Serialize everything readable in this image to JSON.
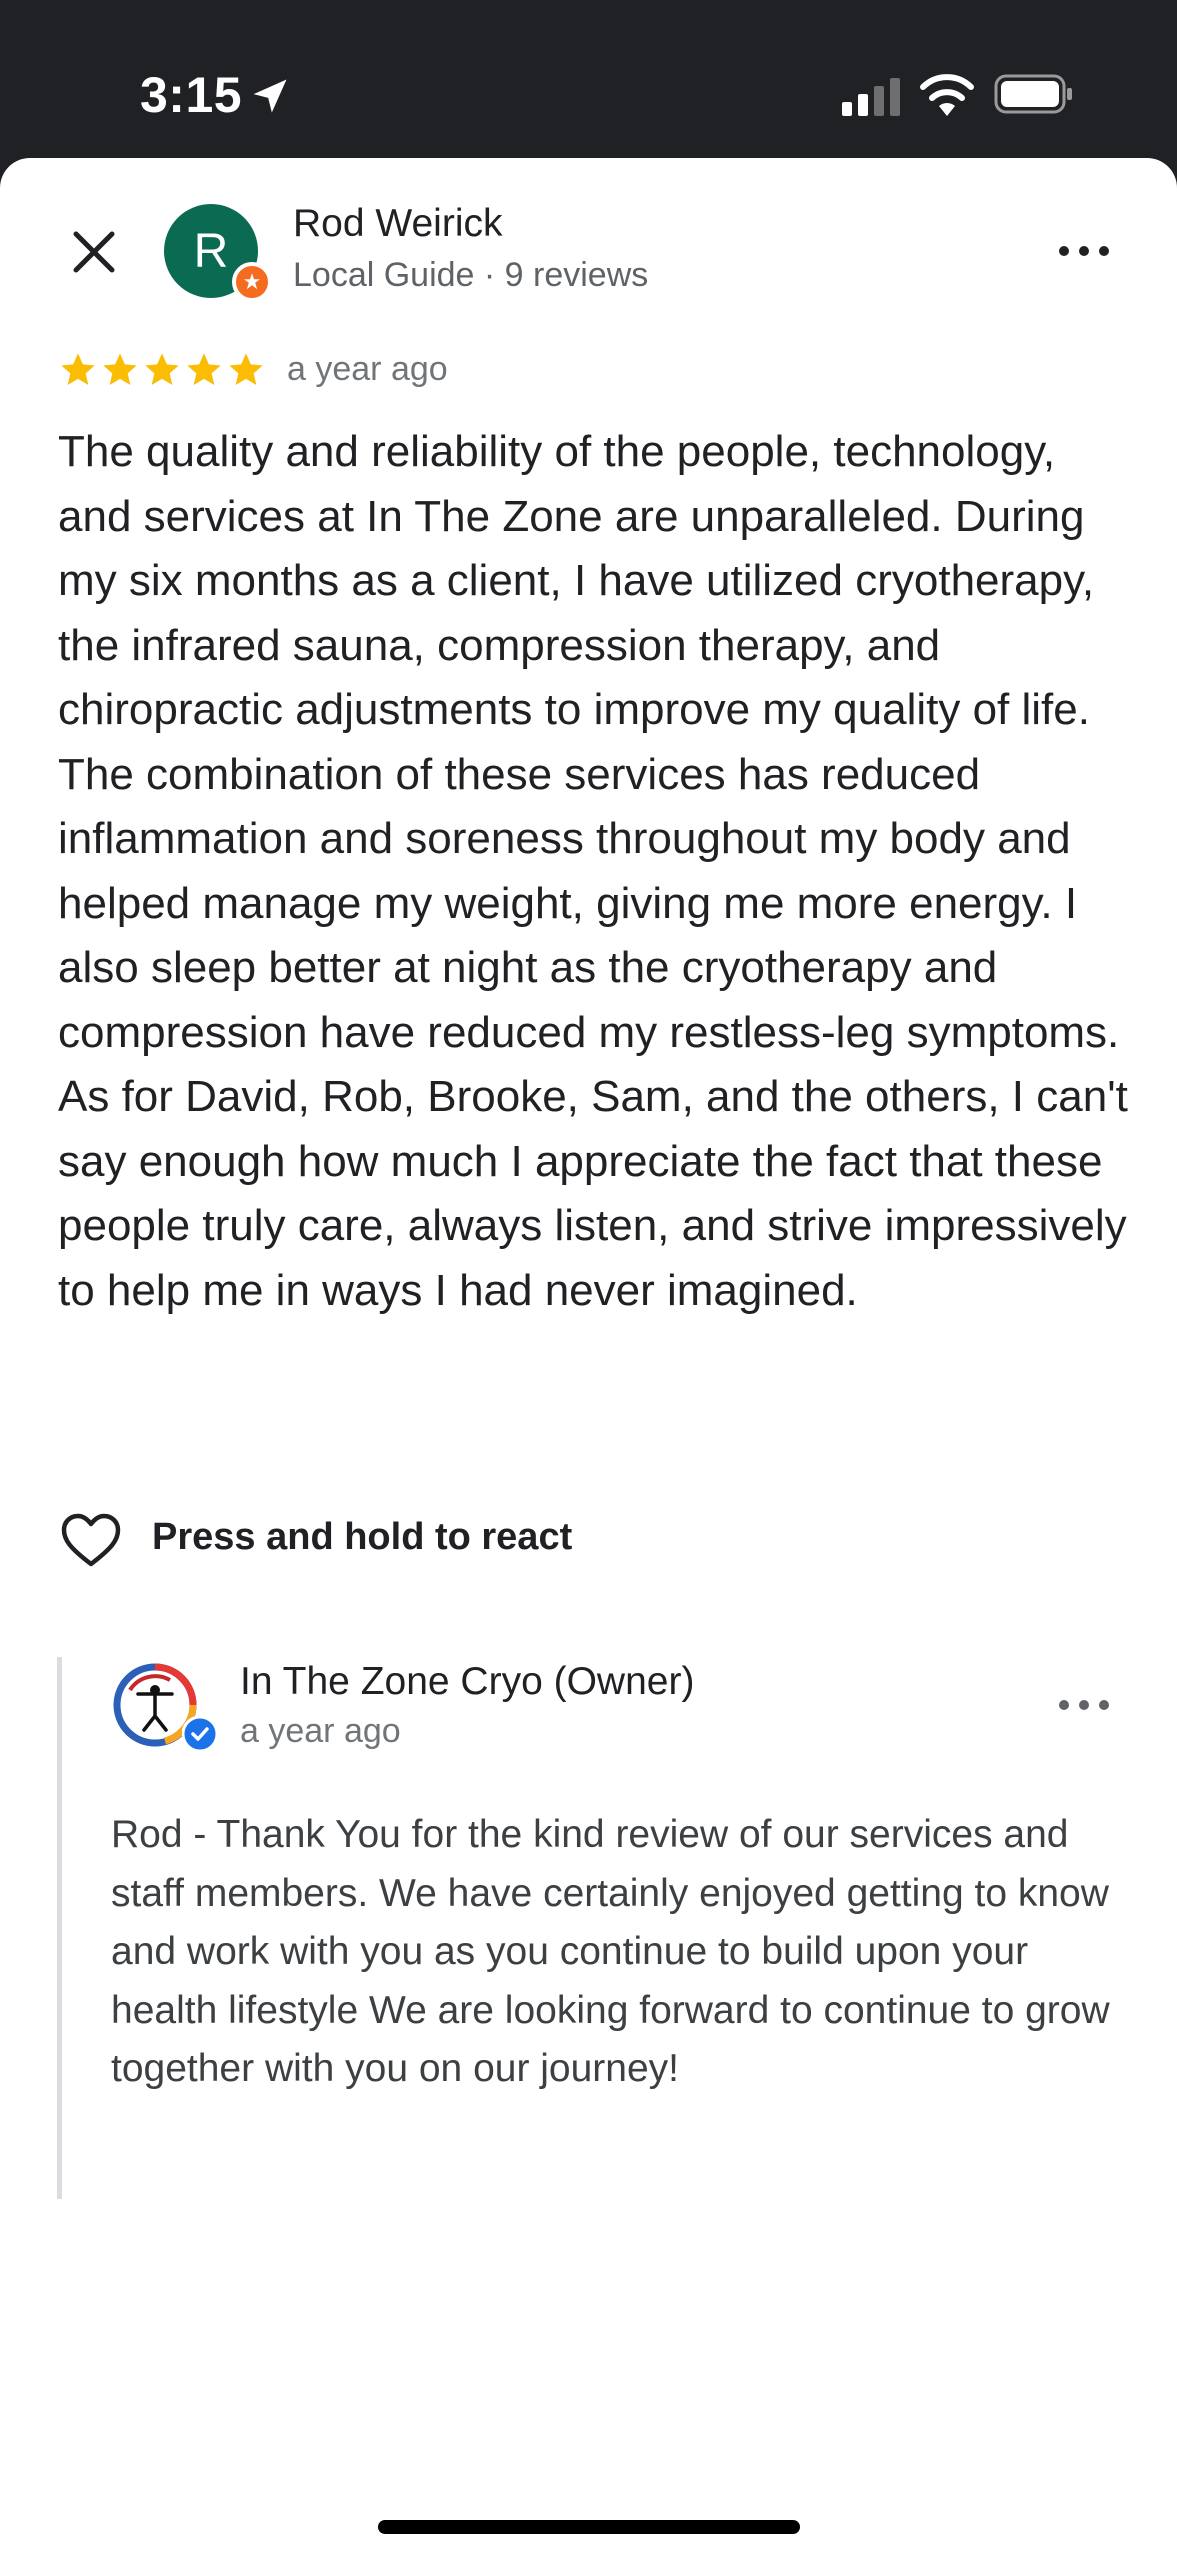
{
  "status_bar": {
    "time": "3:15",
    "icons": [
      "location-arrow-icon",
      "cellular-signal-icon",
      "wifi-icon",
      "battery-icon"
    ]
  },
  "reviewer": {
    "avatar_initial": "R",
    "name": "Rod Weirick",
    "meta": "Local Guide · 9 reviews"
  },
  "review": {
    "rating_stars": 5,
    "time": "a year ago",
    "text": "The quality and reliability of the people, technology, and services at In The Zone are unparalleled. During my six months as a client, I have utilized cryotherapy, the infrared sauna, compression therapy, and chiropractic adjustments to improve my quality of life. The combination of these services has reduced inflammation and soreness throughout my body and helped manage my weight, giving me more energy. I also sleep better at night as the cryotherapy and compression have reduced my restless-leg symptoms. As for David, Rob, Brooke, Sam, and the others, I can't say enough how much I appreciate the fact that these people truly care, always listen, and strive impressively to help me in ways I had never imagined."
  },
  "react": {
    "label": "Press and hold to react"
  },
  "owner_reply": {
    "name": "In The Zone Cryo (Owner)",
    "time": "a year ago",
    "text": "Rod - Thank You for the kind review of our services and staff members. We have certainly enjoyed getting to know and work with you as you continue to build upon your health lifestyle We are looking forward to continue to grow together with you on our journey!"
  },
  "colors": {
    "star": "#fbbc04",
    "avatar_bg": "#0b6b52",
    "local_guide_badge": "#f56b1f",
    "verified_badge": "#1a73e8",
    "status_bar_bg": "#202124"
  }
}
